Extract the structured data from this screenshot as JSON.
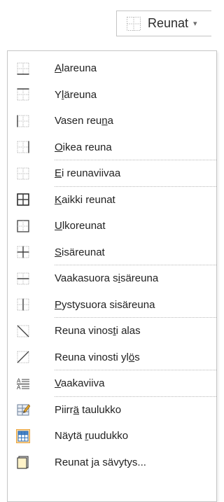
{
  "button": {
    "label": "Reunat",
    "icon": "border-dotted-icon",
    "caret": "▾"
  },
  "menu": {
    "items": [
      {
        "pre": "",
        "u": "A",
        "post": "lareuna",
        "icon": "bottom-border-icon"
      },
      {
        "pre": "Y",
        "u": "l",
        "post": "äreuna",
        "icon": "top-border-icon"
      },
      {
        "pre": "Vasen reu",
        "u": "n",
        "post": "a",
        "icon": "left-border-icon"
      },
      {
        "pre": "",
        "u": "O",
        "post": "ikea reuna",
        "icon": "right-border-icon"
      },
      {
        "pre": "",
        "u": "E",
        "post": "i reunaviivaa",
        "icon": "no-border-icon"
      },
      {
        "pre": "",
        "u": "K",
        "post": "aikki reunat",
        "icon": "all-borders-icon"
      },
      {
        "pre": "",
        "u": "U",
        "post": "lkoreunat",
        "icon": "outside-borders-icon"
      },
      {
        "pre": "",
        "u": "S",
        "post": "isäreunat",
        "icon": "inside-borders-icon"
      },
      {
        "pre": "Vaakasuora s",
        "u": "i",
        "post": "säreuna",
        "icon": "inside-horizontal-border-icon"
      },
      {
        "pre": "",
        "u": "P",
        "post": "ystysuora sisäreuna",
        "icon": "inside-vertical-border-icon"
      },
      {
        "pre": "Reuna vinos",
        "u": "t",
        "post": "i alas",
        "icon": "diagonal-down-border-icon"
      },
      {
        "pre": "Reuna vinosti yl",
        "u": "ö",
        "post": "s",
        "icon": "diagonal-up-border-icon"
      },
      {
        "pre": "",
        "u": "V",
        "post": "aakaviiva",
        "icon": "horizontal-line-icon"
      },
      {
        "pre": "Piirr",
        "u": "ä",
        "post": " taulukko",
        "icon": "draw-table-icon"
      },
      {
        "pre": "Näytä ",
        "u": "r",
        "post": "uudukko",
        "icon": "view-gridlines-icon"
      },
      {
        "pre": "Reunat ",
        "u": "j",
        "post": "a sävytys...",
        "icon": "borders-and-shading-icon"
      }
    ]
  },
  "colors": {
    "menu_border": "#c6c6c6",
    "separator": "#b8b8b8",
    "icon_gray": "#8a8a8a",
    "icon_dots": "#b4b4b4",
    "grid_blue": "#2a6ebb",
    "grid_selected_bg": "#fcd9a3",
    "grid_selected_border": "#e8a33c"
  }
}
